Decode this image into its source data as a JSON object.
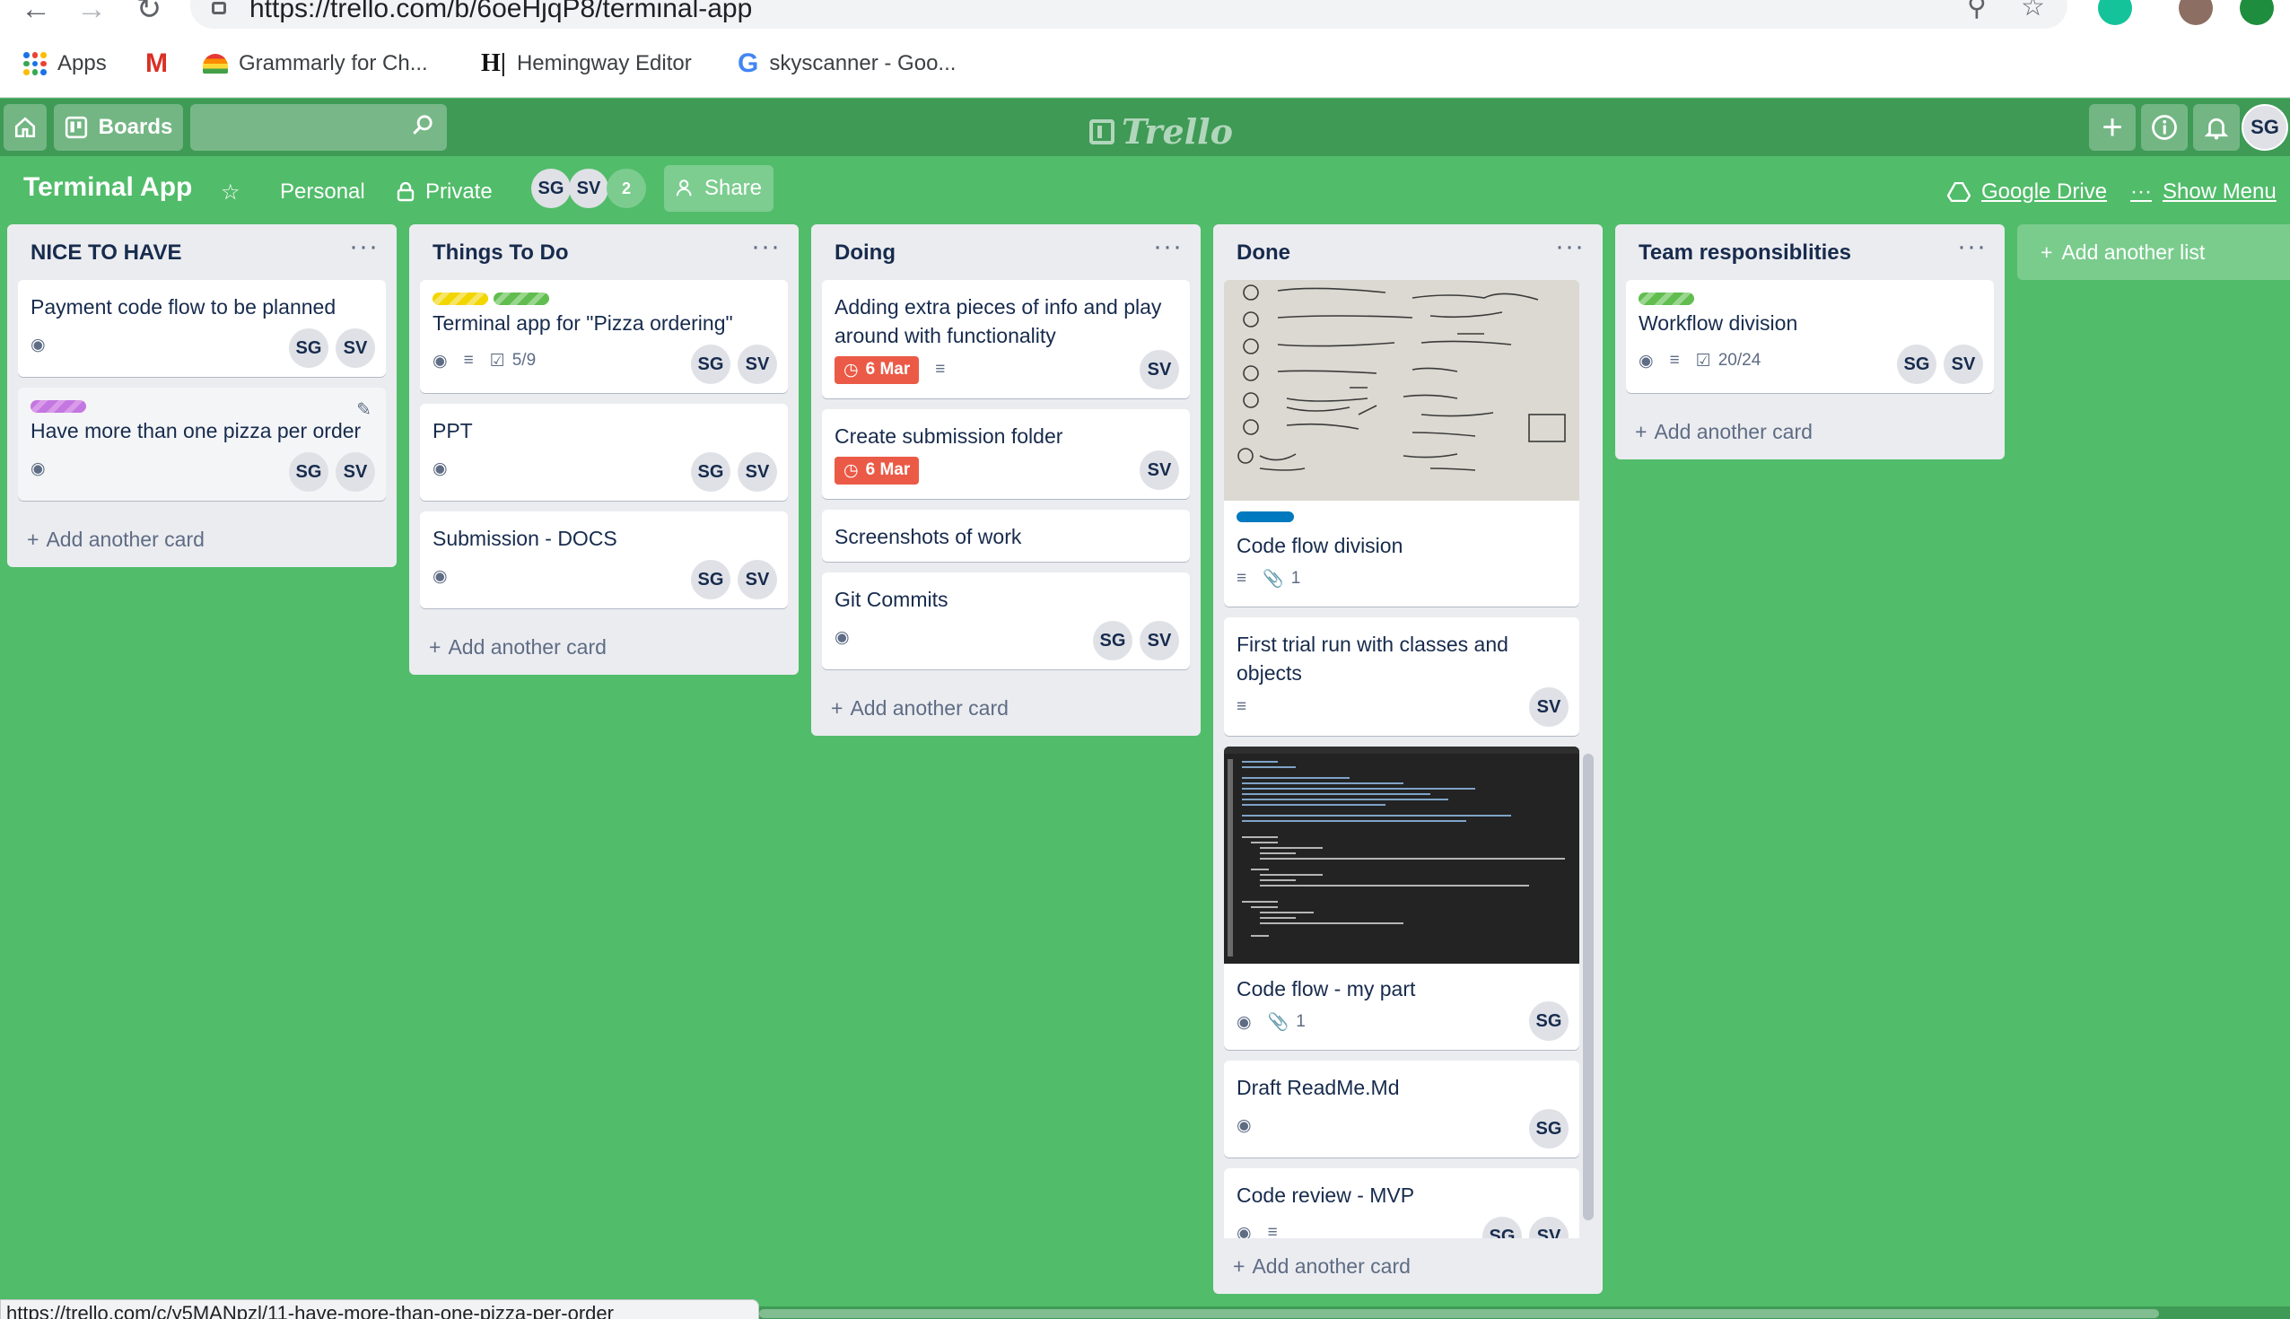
{
  "browser": {
    "url": "https://trello.com/b/6oeHjqP8/terminal-app",
    "bookmarks": [
      {
        "label": "Apps"
      },
      {
        "label": ""
      },
      {
        "label": "Grammarly for Ch..."
      },
      {
        "label": "Hemingway Editor"
      },
      {
        "label": "skyscanner - Goo..."
      }
    ]
  },
  "header": {
    "boards_label": "Boards",
    "search_placeholder": "",
    "logo_text": "Trello",
    "user_initials": "SG"
  },
  "board": {
    "title": "Terminal App",
    "team": "Personal",
    "visibility": "Private",
    "members": [
      "SG",
      "SV"
    ],
    "member_count": "2",
    "share_label": "Share",
    "google_drive": "Google Drive",
    "show_menu": "Show Menu"
  },
  "add_card_label": "Add another card",
  "add_list_label": "Add another list",
  "lists": [
    {
      "title": "NICE TO HAVE",
      "cards": [
        {
          "title": "Payment code flow to be planned",
          "members": [
            "SG",
            "SV"
          ]
        },
        {
          "title": "Have more than one pizza per order",
          "members": [
            "SG",
            "SV"
          ]
        }
      ]
    },
    {
      "title": "Things To Do",
      "cards": [
        {
          "title": "Terminal app for \"Pizza ordering\"",
          "checklist": "5/9",
          "members": [
            "SG",
            "SV"
          ]
        },
        {
          "title": "PPT",
          "members": [
            "SG",
            "SV"
          ]
        },
        {
          "title": "Submission - DOCS",
          "members": [
            "SG",
            "SV"
          ]
        }
      ]
    },
    {
      "title": "Doing",
      "cards": [
        {
          "title": "Adding extra pieces of info and play around with functionality",
          "due": "6 Mar",
          "members": [
            "SV"
          ]
        },
        {
          "title": "Create submission folder",
          "due": "6 Mar",
          "members": [
            "SV"
          ]
        },
        {
          "title": "Screenshots of work"
        },
        {
          "title": "Git Commits",
          "members": [
            "SG",
            "SV"
          ]
        }
      ]
    },
    {
      "title": "Done",
      "cards": [
        {
          "title": "Code flow division",
          "attachments": "1"
        },
        {
          "title": "First trial run with classes and objects",
          "members": [
            "SV"
          ]
        },
        {
          "title": "Code flow - my part",
          "attachments": "1",
          "members": [
            "SG"
          ]
        },
        {
          "title": "Draft ReadMe.Md",
          "members": [
            "SG"
          ]
        },
        {
          "title": "Code review - MVP",
          "members": [
            "SG",
            "SV"
          ]
        }
      ]
    },
    {
      "title": "Team responsiblities",
      "cards": [
        {
          "title": "Workflow division",
          "checklist": "20/24",
          "members": [
            "SG",
            "SV"
          ]
        }
      ]
    }
  ],
  "status_url": "https://trello.com/c/y5MANpzl/11-have-more-than-one-pizza-per-order",
  "colors": {
    "board_bg": "#51bc6a",
    "header_bg": "#3e9a55",
    "label_yellow": "#f2d600",
    "label_green": "#61bd4f",
    "label_purple": "#c377e0",
    "label_blue": "#0079bf",
    "due_red": "#eb5a46"
  }
}
